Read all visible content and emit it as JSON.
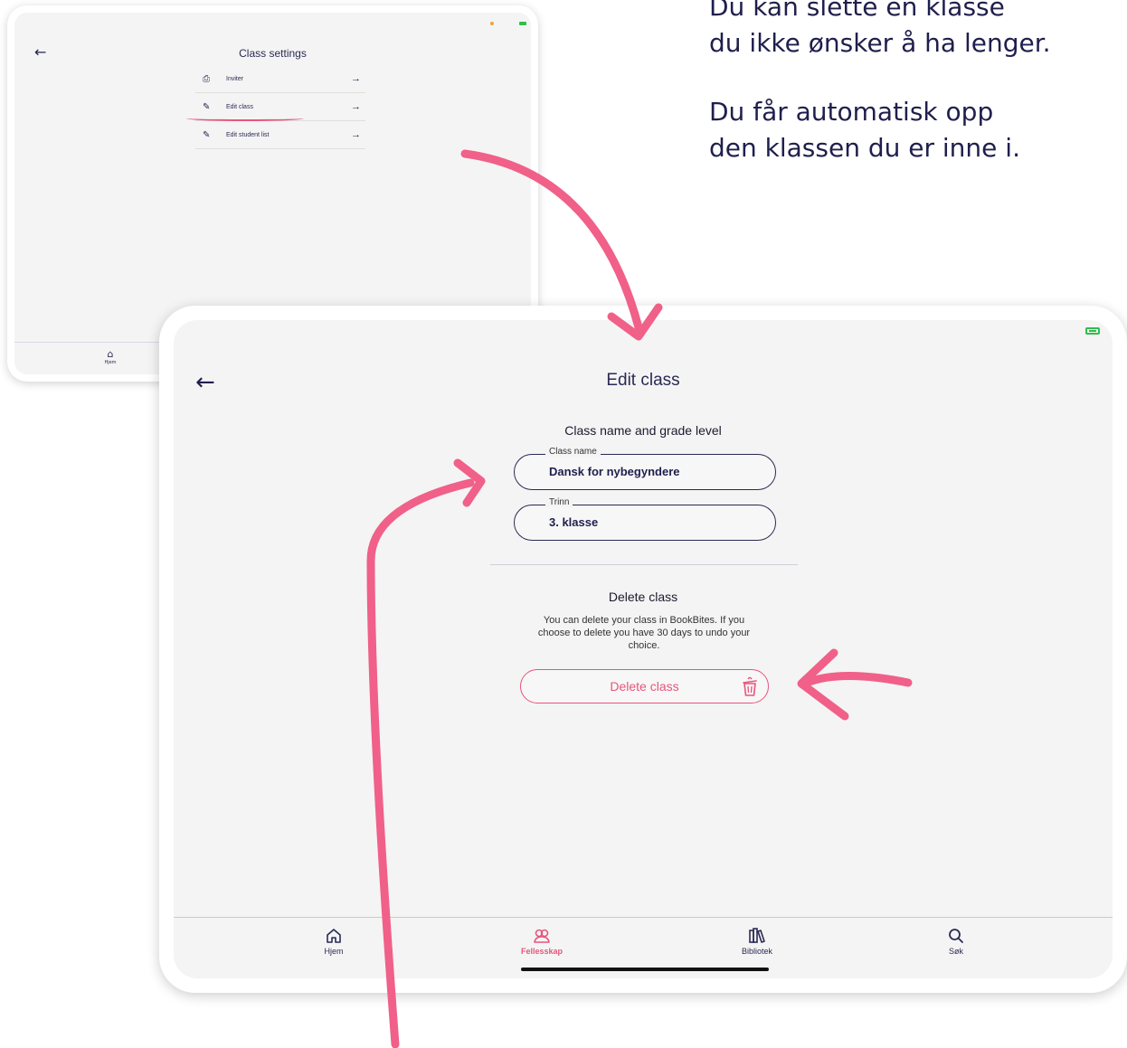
{
  "instructions": {
    "line1": "Du kan slette en klasse",
    "line2": "du ikke ønsker å ha lenger.",
    "line3": "Du får automatisk opp",
    "line4": "den klassen du er inne i."
  },
  "background_screen": {
    "title": "Class settings",
    "menu": [
      {
        "label": "Inviter",
        "icon": "printer-icon"
      },
      {
        "label": "Edit class",
        "icon": "pencil-icon"
      },
      {
        "label": "Edit student list",
        "icon": "pencil-icon"
      }
    ],
    "bottom_nav": {
      "hjem": "Hjem"
    }
  },
  "edit_class": {
    "title": "Edit class",
    "section_heading": "Class name and grade level",
    "class_name": {
      "label": "Class name",
      "value": "Dansk for nybegyndere"
    },
    "trinn": {
      "label": "Trinn",
      "value": "3. klasse"
    },
    "delete_heading": "Delete class",
    "delete_description": "You can delete your class in BookBites. If you choose to delete you have 30 days to undo your choice.",
    "delete_button": "Delete class"
  },
  "nav": {
    "hjem": "Hjem",
    "fellesskap": "Fellesskap",
    "bibliotek": "Bibliotek",
    "sok": "Søk"
  },
  "colors": {
    "accent": "#e8557c",
    "text": "#2a2a55",
    "screen_bg": "#f4f4f4"
  }
}
